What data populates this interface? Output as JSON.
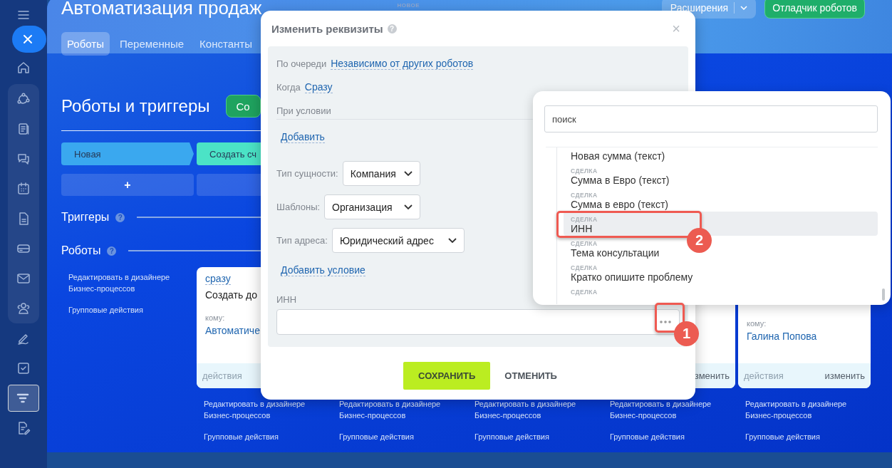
{
  "sidebar": {
    "top": [
      {
        "kind": "menu"
      },
      {
        "kind": "close"
      },
      {
        "kind": "home"
      }
    ],
    "group": [
      {
        "kind": "nodes"
      },
      {
        "kind": "list"
      },
      {
        "kind": "chat"
      },
      {
        "kind": "calendar"
      },
      {
        "kind": "file"
      },
      {
        "kind": "card"
      },
      {
        "kind": "mail"
      },
      {
        "kind": "users"
      }
    ],
    "bottom": [
      {
        "kind": "pen",
        "selected": false
      },
      {
        "kind": "check",
        "selected": false
      },
      {
        "kind": "funnel",
        "selected": true
      },
      {
        "kind": "file-edit",
        "selected": false
      }
    ]
  },
  "header": {
    "title": "Автоматизация продаж",
    "badge": "НОВОЕ",
    "buttons": [
      {
        "label": "Расширения",
        "kind": "split"
      },
      {
        "label": "Отладчик роботов",
        "kind": "primary"
      }
    ]
  },
  "tabs": [
    {
      "label": "Роботы",
      "selected": true
    },
    {
      "label": "Переменные",
      "selected": false
    },
    {
      "label": "Константы",
      "selected": false
    }
  ],
  "section": {
    "title": "Роботы и триггеры",
    "create_button": "Со"
  },
  "stages": [
    {
      "label": "Новая",
      "color": "#3aa8ef",
      "add": "+"
    },
    {
      "label": "Создать сч",
      "color": "#4be3c6"
    }
  ],
  "triggers": {
    "title": "Триггеры",
    "help": "?"
  },
  "robots": {
    "title": "Роботы",
    "help": "?"
  },
  "left_links": [
    "Редактировать в дизайнере Бизнес-процессов",
    "Групповые действия"
  ],
  "robot_columns": [
    {
      "card": {
        "when": "сразу",
        "action": "Создать до",
        "to_label": "кому:",
        "to": "Автоматиче",
        "footer_left": "действия"
      },
      "links": [
        "Редактировать в дизайнере Бизнес-процессов",
        "Групповые действия"
      ]
    },
    {
      "links": [
        "Редактировать в дизайнере Бизнес-процессов",
        "Групповые действия"
      ]
    },
    {
      "links": [
        "Редактировать в дизайнере Бизнес-процессов",
        "Групповые действия"
      ]
    },
    {
      "card": {
        "footer_right": "зменить"
      },
      "links": [
        "Редактировать в дизайнере Бизнес-процессов",
        "Групповые действия"
      ]
    },
    {
      "card": {
        "to_label": "кому:",
        "to": "Галина Попова",
        "footer_left": "действия",
        "footer_right": "изменить"
      },
      "links": [
        "Редактировать в дизайнере Бизнес-процессов",
        "Групповые действия"
      ]
    }
  ],
  "modal": {
    "title": "Изменить реквизиты",
    "help": "?",
    "close": "×",
    "rows": [
      {
        "kind": "link",
        "label": "По очереди",
        "value": "Независимо от других роботов"
      },
      {
        "kind": "link",
        "label": "Когда",
        "value": "Сразу"
      },
      {
        "kind": "heading",
        "label": "При условии"
      },
      {
        "kind": "action",
        "value": "Добавить"
      },
      {
        "kind": "select",
        "label": "Тип сущности:",
        "value": "Компания"
      },
      {
        "kind": "select",
        "label": "Шаблоны:",
        "value": "Организация"
      },
      {
        "kind": "select",
        "label": "Тип адреса:",
        "value": "Юридический адрес"
      },
      {
        "kind": "action",
        "value": "Добавить условие"
      },
      {
        "kind": "input",
        "label": "ИНН"
      }
    ],
    "save": "СОХРАНИТЬ",
    "cancel": "ОТМЕНИТЬ"
  },
  "field_menu": {
    "search": {
      "placeholder": "поиск"
    },
    "items": [
      {
        "name": "Новая сумма (текст)",
        "selected": false
      },
      {
        "group": "СДЕЛКА",
        "name": "Сумма в Евро (текст)",
        "selected": false
      },
      {
        "group": "СДЕЛКА",
        "name": "Сумма в евро (текст)",
        "selected": false
      },
      {
        "group": "СДЕЛКА",
        "name": "ИНН",
        "selected": true
      },
      {
        "group": "СДЕЛКА",
        "name": "Тема консультации",
        "selected": false
      },
      {
        "group": "СДЕЛКА",
        "name": "Кратко опишите проблему",
        "selected": false
      },
      {
        "group": "СДЕЛКА",
        "selected": false
      }
    ]
  },
  "annotations": [
    {
      "label": "1"
    },
    {
      "label": "2"
    }
  ]
}
